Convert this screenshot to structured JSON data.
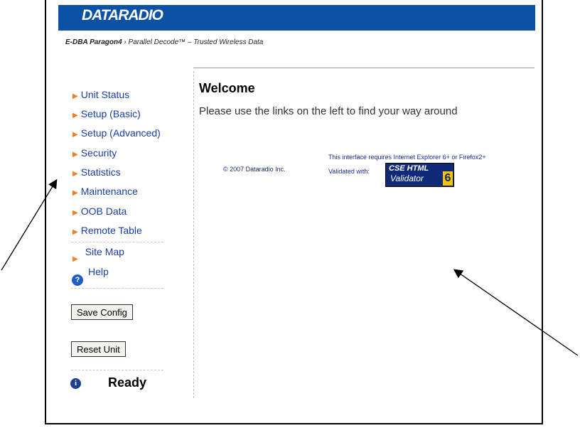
{
  "header": {
    "logo_text": "DATARADIO",
    "brand_color": "#0b52a6"
  },
  "breadcrumb": {
    "product": "E-DBA Paragon4",
    "path": " › Parallel Decode™ – Trusted Wireless Data"
  },
  "sidebar": {
    "items": [
      {
        "label": "Unit Status"
      },
      {
        "label": "Setup (Basic)"
      },
      {
        "label": "Setup (Advanced)"
      },
      {
        "label": "Security"
      },
      {
        "label": "Statistics"
      },
      {
        "label": "Maintenance"
      },
      {
        "label": "OOB Data"
      },
      {
        "label": "Remote Table"
      }
    ],
    "site_map": "Site Map",
    "help": "Help",
    "save_button": "Save Config",
    "reset_button": "Reset Unit",
    "status": "Ready"
  },
  "main": {
    "title": "Welcome",
    "text": "Please use the links on the left to find your way around",
    "copyright": "© 2007 Dataradio Inc.",
    "requirement": "This interface requires Internet Explorer 6+ or Firefox2+",
    "validated_label": "Validated with:",
    "badge": {
      "line1": "CSE HTML",
      "line2": "Validator",
      "version": "6"
    }
  }
}
